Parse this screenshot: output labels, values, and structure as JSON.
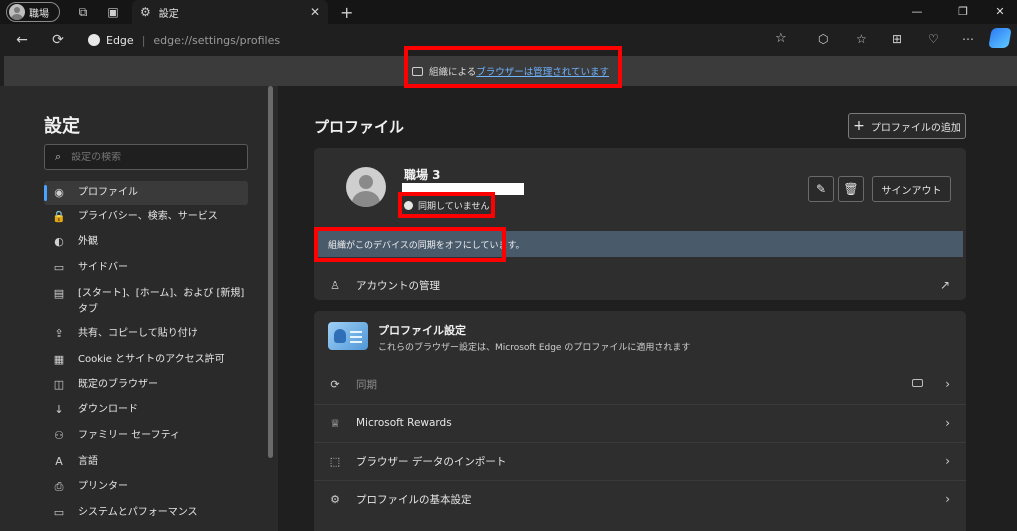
{
  "tabbar": {
    "profile_label": "職場",
    "tab_title": "設定",
    "tab_close": "✕",
    "new_tab": "+",
    "win_min": "—",
    "win_restore": "❐",
    "win_close": "✕"
  },
  "addressbar": {
    "brand": "Edge",
    "separator": "|",
    "url": "edge://settings/profiles"
  },
  "banner": {
    "prefix": "組織による",
    "link": "ブラウザーは管理されています"
  },
  "sidebar": {
    "title": "設定",
    "search_placeholder": "設定の検索",
    "items": [
      {
        "label": "プロファイル",
        "icon": "profile-icon",
        "glyph": "◉"
      },
      {
        "label": "プライバシー、検索、サービス",
        "icon": "lock-icon",
        "glyph": "🔒"
      },
      {
        "label": "外観",
        "icon": "appearance-icon",
        "glyph": "◐"
      },
      {
        "label": "サイドバー",
        "icon": "sidebar-icon",
        "glyph": "▭"
      },
      {
        "label": "[スタート]、[ホーム]、および [新規] タブ",
        "icon": "home-tabs-icon",
        "glyph": "▤"
      },
      {
        "label": "共有、コピーして貼り付け",
        "icon": "share-icon",
        "glyph": "⇪"
      },
      {
        "label": "Cookie とサイトのアクセス許可",
        "icon": "cookie-icon",
        "glyph": "▦"
      },
      {
        "label": "既定のブラウザー",
        "icon": "default-browser-icon",
        "glyph": "◫"
      },
      {
        "label": "ダウンロード",
        "icon": "download-icon",
        "glyph": "↓"
      },
      {
        "label": "ファミリー セーフティ",
        "icon": "family-icon",
        "glyph": "⚇"
      },
      {
        "label": "言語",
        "icon": "language-icon",
        "glyph": "A"
      },
      {
        "label": "プリンター",
        "icon": "printer-icon",
        "glyph": "⎙"
      },
      {
        "label": "システムとパフォーマンス",
        "icon": "system-icon",
        "glyph": "▭"
      }
    ]
  },
  "main": {
    "title": "プロファイル",
    "add_profile": "プロファイルの追加",
    "profile": {
      "name": "職場 3",
      "sync_status": "同期していません",
      "signout": "サインアウト"
    },
    "notice": "組織がこのデバイスの同期をオフにしています。",
    "manage_account": "アカウントの管理",
    "settings_section": {
      "title": "プロファイル設定",
      "description": "これらのブラウザー設定は、Microsoft Edge のプロファイルに適用されます"
    },
    "rows": [
      {
        "label": "同期",
        "icon": "sync-icon",
        "glyph": "⟳"
      },
      {
        "label": "Microsoft Rewards",
        "icon": "rewards-icon",
        "glyph": "♕"
      },
      {
        "label": "ブラウザー データのインポート",
        "icon": "import-icon",
        "glyph": "⬚"
      },
      {
        "label": "プロファイルの基本設定",
        "icon": "profile-preferences-icon",
        "glyph": "⚙"
      }
    ]
  }
}
